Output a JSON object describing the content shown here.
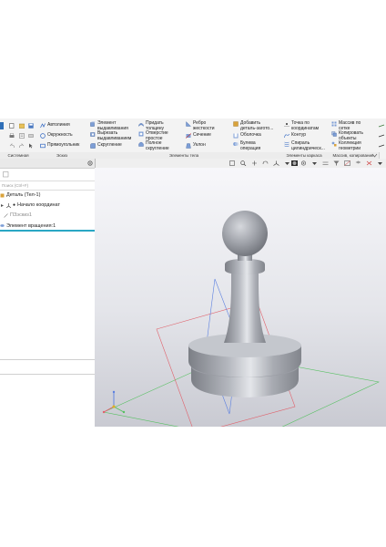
{
  "ribbon": {
    "col1": [
      {
        "label": "Автолиния",
        "icon": "polyline-icon"
      },
      {
        "label": "Окружность",
        "icon": "circle-icon"
      },
      {
        "label": "Прямоугольник",
        "icon": "rectangle-icon"
      }
    ],
    "col2": [
      {
        "label": "Элемент\nвыдавливания",
        "icon": "extrude-icon"
      },
      {
        "label": "Вырезать\nвыдавливанием",
        "icon": "cut-extrude-icon"
      },
      {
        "label": "Скругление",
        "icon": "fillet-icon"
      }
    ],
    "col3": [
      {
        "label": "Придать\nтолщину",
        "icon": "thicken-icon"
      },
      {
        "label": "Отверстие\nпростое",
        "icon": "hole-icon"
      },
      {
        "label": "Полное\nскругление",
        "icon": "full-round-icon"
      }
    ],
    "col4": [
      {
        "label": "Ребро\nжесткости",
        "icon": "rib-icon"
      },
      {
        "label": "Сечение",
        "icon": "section-icon"
      },
      {
        "label": "Уклон",
        "icon": "draft-icon"
      }
    ],
    "col5": [
      {
        "label": "Добавить\nдеталь-загото...",
        "icon": "add-part-icon"
      },
      {
        "label": "Оболочка",
        "icon": "shell-icon"
      },
      {
        "label": "Булева\nоперация",
        "icon": "boolean-icon"
      }
    ],
    "col6": [
      {
        "label": "Точка по\nкоординатам",
        "icon": "point-icon"
      },
      {
        "label": "Контур",
        "icon": "contour-icon"
      },
      {
        "label": "Спираль\nцилиндрическ...",
        "icon": "helix-icon"
      }
    ],
    "col7": [
      {
        "label": "Массив по\nсетке",
        "icon": "grid-array-icon"
      },
      {
        "label": "Копировать\nобъекты",
        "icon": "copy-objects-icon"
      },
      {
        "label": "Коллекция\nгеометрии",
        "icon": "geometry-collection-icon"
      }
    ],
    "groups": [
      "Системная",
      "Эскиз",
      "Элементы тела",
      "Элементы каркаса",
      "Массив, копирование"
    ]
  },
  "tree": {
    "search_placeholder": "Поиск (Ctrl+F)",
    "items": [
      {
        "label": "Деталь (Тел-1)",
        "icon": "part-icon"
      },
      {
        "label": "Начало координат",
        "icon": "origin-icon"
      },
      {
        "label": "ПЗэскиз1",
        "icon": "sketch-icon"
      },
      {
        "label": "Элемент вращения:1",
        "icon": "revolve-icon"
      }
    ]
  },
  "colors": {
    "accent": "#2aa7c4",
    "plane_red": "#e0606a",
    "plane_green": "#55c060",
    "plane_blue": "#5a7fe0",
    "model": "#a8abb2"
  }
}
